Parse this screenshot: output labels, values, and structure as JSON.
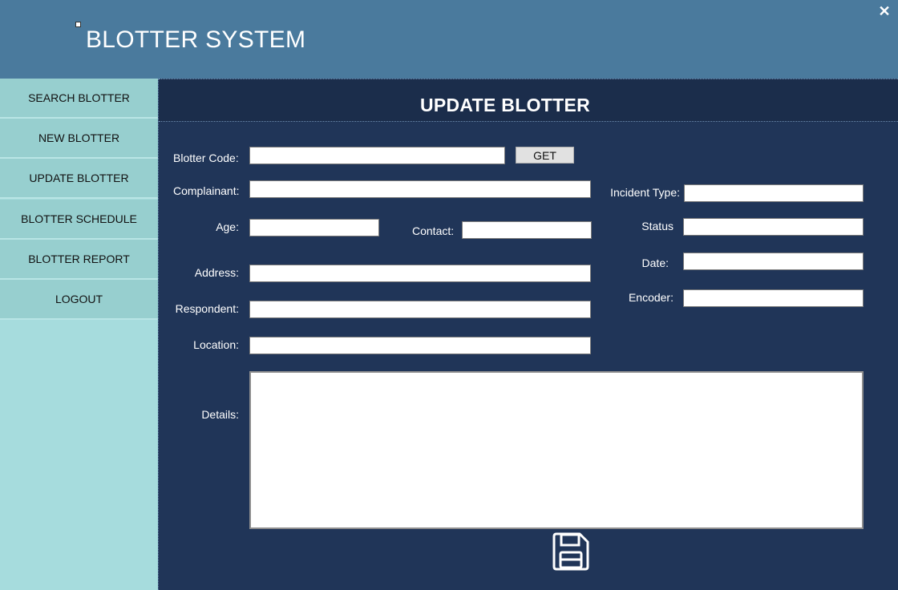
{
  "header": {
    "title": "BLOTTER SYSTEM",
    "close_label": "✕"
  },
  "sidebar": {
    "items": [
      {
        "label": "SEARCH BLOTTER"
      },
      {
        "label": "NEW BLOTTER"
      },
      {
        "label": "UPDATE BLOTTER"
      },
      {
        "label": "BLOTTER SCHEDULE"
      },
      {
        "label": "BLOTTER REPORT"
      },
      {
        "label": "LOGOUT"
      }
    ]
  },
  "main": {
    "title": "UPDATE BLOTTER",
    "get_label": "GET",
    "fields": {
      "blotter_code": {
        "label": "Blotter Code:",
        "value": ""
      },
      "complainant": {
        "label": "Complainant:",
        "value": ""
      },
      "age": {
        "label": "Age:",
        "value": ""
      },
      "contact": {
        "label": "Contact:",
        "value": ""
      },
      "address": {
        "label": "Address:",
        "value": ""
      },
      "respondent": {
        "label": "Respondent:",
        "value": ""
      },
      "location": {
        "label": "Location:",
        "value": ""
      },
      "details": {
        "label": "Details:",
        "value": ""
      },
      "incident_type": {
        "label": "Incident Type:",
        "value": ""
      },
      "status": {
        "label": "Status",
        "value": ""
      },
      "date": {
        "label": "Date:",
        "value": ""
      },
      "encoder": {
        "label": "Encoder:",
        "value": ""
      }
    },
    "save_icon": "floppy-disk-icon"
  },
  "colors": {
    "header": "#4a7a9d",
    "sidebar": "#a6dcdd",
    "nav_item": "#97cfcf",
    "main": "#203558",
    "main_header": "#1b2d4b"
  }
}
